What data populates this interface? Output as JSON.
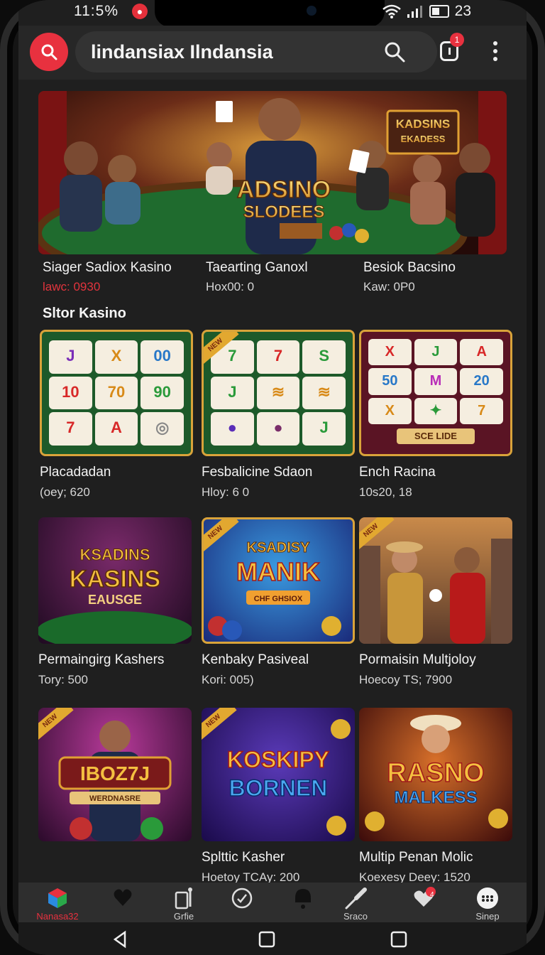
{
  "status": {
    "time": "11:5%",
    "notif_badge": "●",
    "battery": "23"
  },
  "header": {
    "search_text": "lindansiax Ilndansia",
    "notification_count": "1"
  },
  "featured": [
    {
      "title": "Siager Sadiox Kasino",
      "sub": "lawc: 0930",
      "sub_color": "#e2343d"
    },
    {
      "title": "Taearting Ganoxl",
      "sub": "Hox00: 0"
    },
    {
      "title": "Besiok Bacsino",
      "sub": "Kaw: 0P0"
    }
  ],
  "banner": {
    "headline": "ADSINO",
    "subline": "SLODEES",
    "sign_line1": "KADSINS",
    "sign_line2": "EKADESS"
  },
  "section_title": "Sltor Kasino",
  "slots": [
    {
      "title": "Placadadan",
      "sub": "(oey; 620",
      "reels": [
        "J",
        "X",
        "00",
        "10",
        "70",
        "90",
        "7",
        "A",
        "◎"
      ]
    },
    {
      "title": "Fesbalicine Sdaon",
      "sub": "Hloy: 6  0",
      "reels": [
        "7",
        "7",
        "S",
        "J",
        "≋",
        "≋",
        "●",
        "●",
        "J"
      ]
    },
    {
      "title": "Ench Racina",
      "sub": "10s20, 18",
      "reels": [
        "X",
        "J",
        "A",
        "50",
        "M",
        "20",
        "X",
        "✦",
        "7"
      ],
      "plate": "SCE LIDE"
    }
  ],
  "games_row2": [
    {
      "title": "Permaingirg Kashers",
      "sub": "Tory: 500",
      "art1": "KSADINS",
      "art2": "KASINS",
      "art3": "EAUSGE"
    },
    {
      "title": "Kenbaky Pasiveal",
      "sub": "Kori: 005)",
      "art1": "KSADISY",
      "art2": "MANIK",
      "art3": "CHF GHSIOX",
      "tag": "NEW"
    },
    {
      "title": "Pormaisin Multjoloy",
      "sub": "Hoecoy TS; 7900",
      "tag": "NEW"
    }
  ],
  "games_row3": [
    {
      "title": "",
      "sub": "",
      "art1": "IBOZ7J",
      "art2": "WERDNASRE",
      "tag": "NEW"
    },
    {
      "title": "Splttic Kasher",
      "sub": "Hoetoy TCAy: 200",
      "art1": "KOSKIPY",
      "art2": "BORNEN",
      "tag": "NEW"
    },
    {
      "title": "Multip Penan Molic",
      "sub": "Koexesy Deey: 1520",
      "art1": "RASNO",
      "art2": "MALKESS"
    }
  ],
  "nav": [
    {
      "label": "Nanasa32",
      "icon": "cube-icon",
      "active": true
    },
    {
      "label": "",
      "icon": "heart-icon"
    },
    {
      "label": "Grfie",
      "icon": "tools-icon"
    },
    {
      "label": "",
      "icon": "clock-icon"
    },
    {
      "label": "",
      "icon": "bell-icon"
    },
    {
      "label": "Sraco",
      "icon": "pin-icon"
    },
    {
      "label": "",
      "icon": "heart-badge-icon",
      "badge": "4"
    },
    {
      "label": "Sinep",
      "icon": "dots-icon"
    }
  ],
  "colors": {
    "accent": "#e8313f",
    "background": "#1f1f1f",
    "header": "#272727",
    "gold": "#e2a830"
  }
}
